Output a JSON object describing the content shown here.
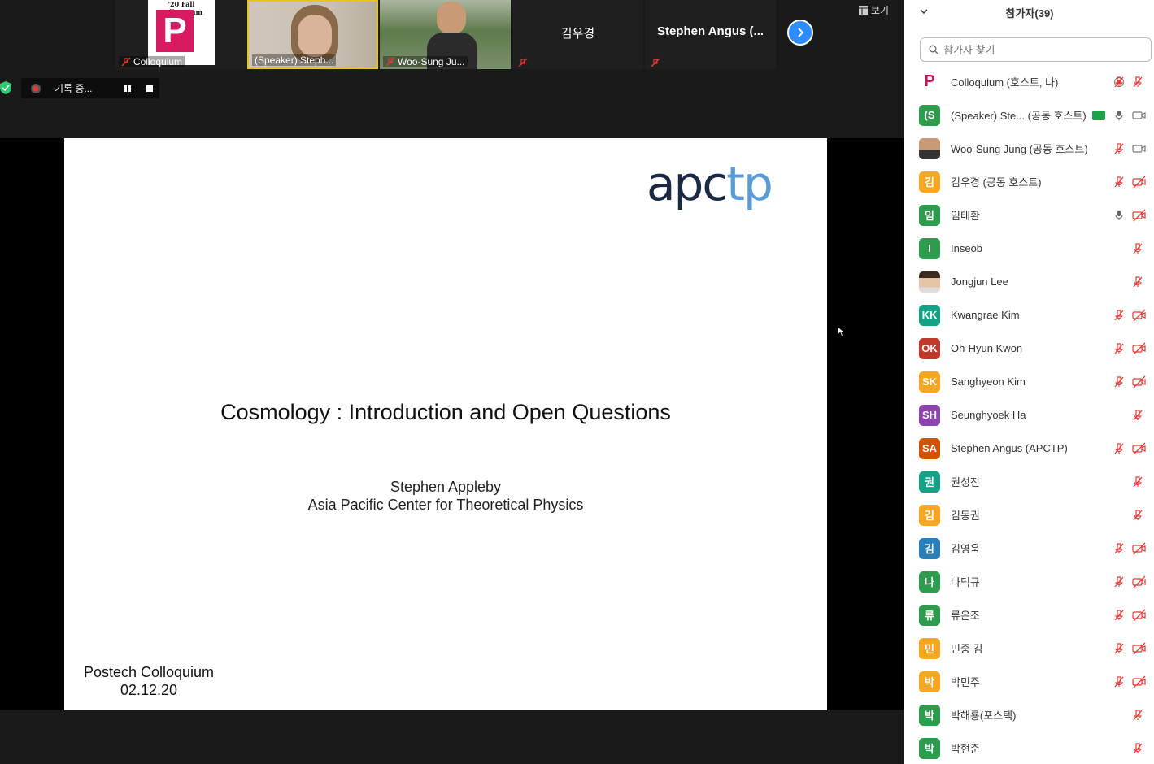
{
  "top_tiles": [
    {
      "label": "Colloquium",
      "logo_text": "'20 Fall Colloquium",
      "logo_letter": "P",
      "mic_off": true
    },
    {
      "label": "(Speaker) Steph...",
      "mic_off": false
    },
    {
      "label": "Woo-Sung Ju...",
      "mic_off": true
    },
    {
      "label": "김우경",
      "mic_off": true
    },
    {
      "label": "Stephen Angus (...",
      "mic_off": true
    }
  ],
  "view_button": "보기",
  "recording": {
    "label": "기록 중..."
  },
  "slide": {
    "logo_dark": "apc",
    "logo_light": "tp",
    "title": "Cosmology : Introduction and Open Questions",
    "speaker_name": "Stephen Appleby",
    "speaker_affiliation": "Asia Pacific Center for Theoretical Physics",
    "event": "Postech Colloquium",
    "date": "02.12.20"
  },
  "panel": {
    "title": "참가자(39)",
    "search_placeholder": "참가자 찾기",
    "participants": [
      {
        "name": "Colloquium (호스트, 나)",
        "initial": "P",
        "color": "#c2185b",
        "mic": "off",
        "cam": "none",
        "extra": "record"
      },
      {
        "name": "(Speaker) Ste...  (공동 호스트)",
        "initial": "(S",
        "color": "#2e9b4e",
        "mic": "on",
        "cam": "on",
        "extra": "share"
      },
      {
        "name": "Woo-Sung Jung (공동 호스트)",
        "initial": "",
        "color": "#8d6e63",
        "mic": "off",
        "cam": "on",
        "extra": ""
      },
      {
        "name": "김우경 (공동 호스트)",
        "initial": "김",
        "color": "#f5a623",
        "mic": "off",
        "cam": "off",
        "extra": ""
      },
      {
        "name": "임태환",
        "initial": "임",
        "color": "#2e9b4e",
        "mic": "on",
        "cam": "off",
        "extra": ""
      },
      {
        "name": "Inseob",
        "initial": "I",
        "color": "#2e9b4e",
        "mic": "none",
        "cam": "offonly",
        "extra": ""
      },
      {
        "name": "Jongjun Lee",
        "initial": "",
        "color": "#9e9e9e",
        "mic": "none",
        "cam": "offonly",
        "extra": ""
      },
      {
        "name": "Kwangrae Kim",
        "initial": "KK",
        "color": "#16a085",
        "mic": "off",
        "cam": "off",
        "extra": ""
      },
      {
        "name": "Oh-Hyun Kwon",
        "initial": "OK",
        "color": "#c0392b",
        "mic": "off",
        "cam": "off",
        "extra": ""
      },
      {
        "name": "Sanghyeon Kim",
        "initial": "SK",
        "color": "#f5a623",
        "mic": "off",
        "cam": "off",
        "extra": ""
      },
      {
        "name": "Seunghyoek Ha",
        "initial": "SH",
        "color": "#8e44ad",
        "mic": "none",
        "cam": "offonly",
        "extra": ""
      },
      {
        "name": "Stephen Angus (APCTP)",
        "initial": "SA",
        "color": "#d35400",
        "mic": "off",
        "cam": "off",
        "extra": ""
      },
      {
        "name": "권성진",
        "initial": "권",
        "color": "#16a085",
        "mic": "none",
        "cam": "offonly",
        "extra": ""
      },
      {
        "name": "김동권",
        "initial": "김",
        "color": "#f5a623",
        "mic": "none",
        "cam": "offonly",
        "extra": ""
      },
      {
        "name": "김영욱",
        "initial": "김",
        "color": "#2980b9",
        "mic": "off",
        "cam": "off",
        "extra": ""
      },
      {
        "name": "나덕규",
        "initial": "나",
        "color": "#2e9b4e",
        "mic": "off",
        "cam": "off",
        "extra": ""
      },
      {
        "name": "류은조",
        "initial": "류",
        "color": "#2e9b4e",
        "mic": "off",
        "cam": "off",
        "extra": ""
      },
      {
        "name": "민중 김",
        "initial": "민",
        "color": "#f5a623",
        "mic": "off",
        "cam": "off",
        "extra": ""
      },
      {
        "name": "박민주",
        "initial": "박",
        "color": "#f5a623",
        "mic": "off",
        "cam": "off",
        "extra": ""
      },
      {
        "name": "박해룡(포스텍)",
        "initial": "박",
        "color": "#2e9b4e",
        "mic": "none",
        "cam": "offonly",
        "extra": ""
      },
      {
        "name": "박현준",
        "initial": "박",
        "color": "#2e9b4e",
        "mic": "none",
        "cam": "offonly",
        "extra": ""
      }
    ]
  }
}
